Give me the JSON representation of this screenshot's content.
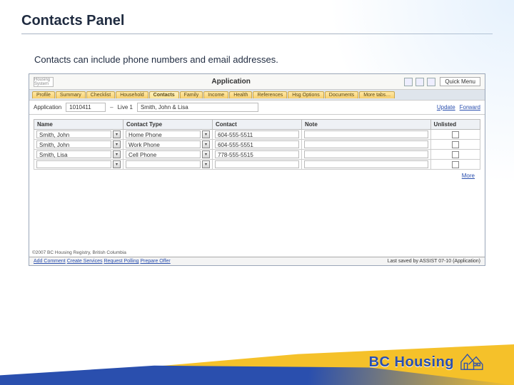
{
  "slide": {
    "title": "Contacts Panel",
    "subtitle": "Contacts can include phone numbers and email addresses."
  },
  "app": {
    "brand_text": "Housing System",
    "title": "Application",
    "quick_menu": "Quick Menu"
  },
  "tabs": [
    {
      "label": "Profile"
    },
    {
      "label": "Summary"
    },
    {
      "label": "Checklist"
    },
    {
      "label": "Household"
    },
    {
      "label": "Contacts",
      "active": true
    },
    {
      "label": "Family"
    },
    {
      "label": "Income"
    },
    {
      "label": "Health"
    },
    {
      "label": "References"
    },
    {
      "label": "Hsg Options"
    },
    {
      "label": "Documents"
    },
    {
      "label": "More tabs…"
    }
  ],
  "breadcrumb": {
    "label": "Application",
    "code": "1010411",
    "dash": "–",
    "seq": "Live 1",
    "name": "Smith, John & Lisa",
    "links": {
      "update": "Update",
      "forward": "Forward"
    }
  },
  "grid": {
    "headers": {
      "name": "Name",
      "type": "Contact Type",
      "contact": "Contact",
      "note": "Note",
      "unlisted": "Unlisted"
    },
    "rows": [
      {
        "name": "Smith, John",
        "type": "Home Phone",
        "contact": "604-555-5511",
        "note": "",
        "unlisted": false
      },
      {
        "name": "Smith, John",
        "type": "Work Phone",
        "contact": "604-555-5551",
        "note": "",
        "unlisted": false
      },
      {
        "name": "Smith, Lisa",
        "type": "Cell Phone",
        "contact": "778-555-5515",
        "note": "",
        "unlisted": false
      },
      {
        "name": "",
        "type": "",
        "contact": "",
        "note": "",
        "unlisted": false
      }
    ],
    "more": "More"
  },
  "status": {
    "links": [
      "Add Comment",
      "Create Services",
      "Request Polling",
      "Prepare Offer"
    ],
    "right": "Last saved by  ASSIST  07-10 (Application)",
    "copyright": "©2007 BC Housing Registry, British Columbia"
  },
  "logo": {
    "text": "BC Housing"
  }
}
